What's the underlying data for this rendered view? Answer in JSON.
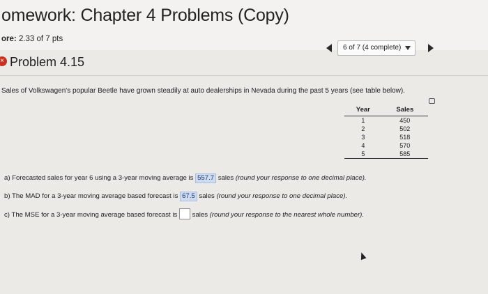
{
  "header": {
    "title": "omework: Chapter 4 Problems (Copy)",
    "score_label": "ore:",
    "score_value": "2.33 of 7 pts"
  },
  "navigator": {
    "position_label": "6 of 7 (4 complete)"
  },
  "problem": {
    "status_icon": "x-circle-icon",
    "title": "Problem 4.15",
    "prompt": "Sales of Volkswagen's popular Beetle have grown steadily at auto dealerships in Nevada during the past 5 years (see table below)."
  },
  "table": {
    "headers": [
      "Year",
      "Sales"
    ],
    "rows": [
      {
        "year": "1",
        "sales": "450"
      },
      {
        "year": "2",
        "sales": "502"
      },
      {
        "year": "3",
        "sales": "518"
      },
      {
        "year": "4",
        "sales": "570"
      },
      {
        "year": "5",
        "sales": "585"
      }
    ]
  },
  "questions": {
    "a": {
      "text": "a) Forecasted sales for year 6 using a 3-year moving average is",
      "answer": "557.7",
      "after": "sales",
      "hint": "(round your response to one decimal place)."
    },
    "b": {
      "text": "b) The MAD for a 3-year moving average based forecast is",
      "answer": "67.5",
      "after": "sales",
      "hint": "(round your response to one decimal place)."
    },
    "c": {
      "text": "c) The MSE for a 3-year moving average based forecast is",
      "answer": "",
      "after": "sales",
      "hint": "(round your response to the nearest whole number)."
    }
  },
  "colors": {
    "answer_highlight": "#cfdcf0",
    "incorrect_icon": "#c8321f"
  }
}
